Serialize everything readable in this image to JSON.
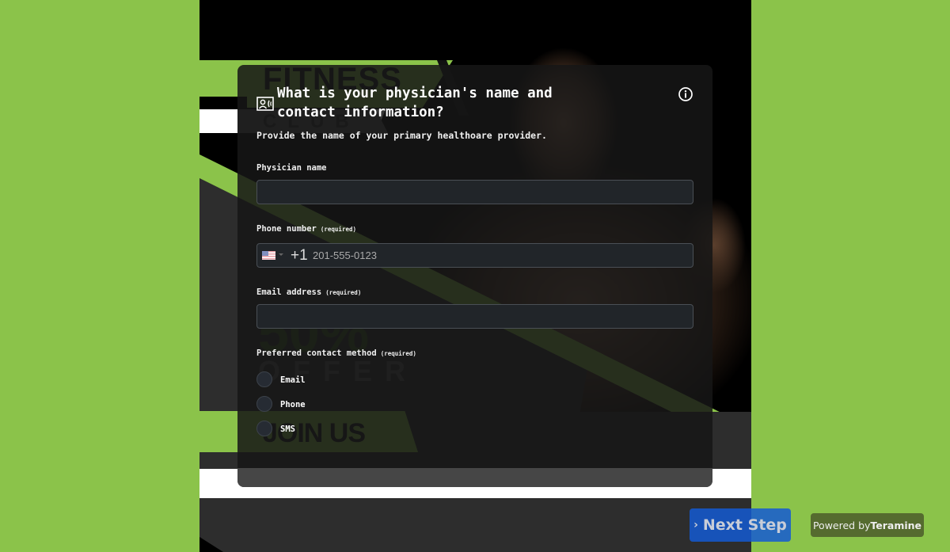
{
  "poster": {
    "headline": "FITNESS",
    "subline": "CLUB",
    "discount": "50%",
    "offer": "OFFER",
    "cta": "JOIN US"
  },
  "question": {
    "icon": "contact-phone-icon",
    "title": "What is your physician's name and contact information?",
    "subtitle": "Provide the name of your primary healthoare provider.",
    "info_icon": "info-icon"
  },
  "fields": {
    "physician_name": {
      "label": "Physician name",
      "value": "",
      "placeholder": ""
    },
    "phone": {
      "label": "Phone number",
      "required": "(required)",
      "country_flag": "us-flag-icon",
      "dial_code": "+1",
      "value": "",
      "placeholder": "201-555-0123"
    },
    "email": {
      "label": "Email address",
      "required": "(required)",
      "value": "",
      "placeholder": ""
    },
    "contact_method": {
      "label": "Preferred contact method",
      "required": "(required)",
      "options": [
        {
          "label": "Email",
          "selected": false
        },
        {
          "label": "Phone",
          "selected": false
        },
        {
          "label": "SMS",
          "selected": false
        }
      ]
    }
  },
  "actions": {
    "next_label": "Next Step",
    "next_icon": "chevron-right-icon"
  },
  "branding": {
    "powered_prefix": "Powered by",
    "powered_brand": "Teramine"
  },
  "colors": {
    "page_bg": "#8bc34a",
    "card_bg": "#161616",
    "input_bg": "#212529",
    "next_button": "#1460d2",
    "powered_bg": "#556b2f"
  }
}
